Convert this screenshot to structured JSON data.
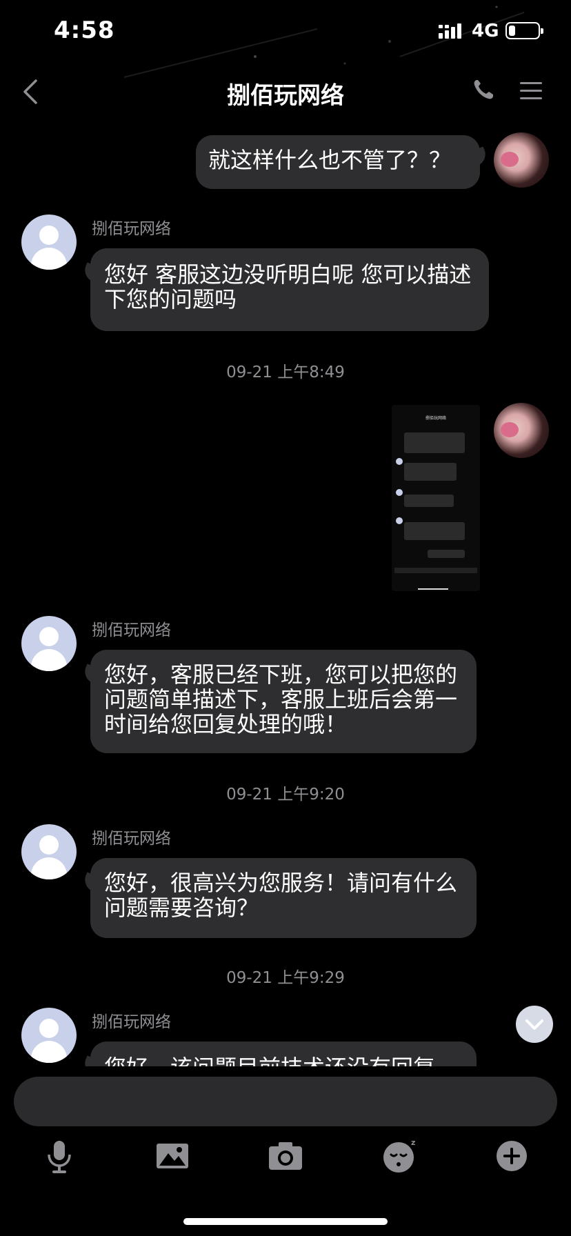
{
  "status_bar": {
    "time": "4:58",
    "network": "4G"
  },
  "nav": {
    "title": "捌佰玩网络"
  },
  "messages": [
    {
      "from": "me",
      "text": "就这样什么也不管了？？"
    },
    {
      "from": "agent",
      "sender": "捌佰玩网络",
      "text": "您好 客服这边没听明白呢 您可以描述下您的问题吗"
    },
    {
      "timestamp": "09-21 上午8:49"
    },
    {
      "from": "me",
      "type": "image"
    },
    {
      "from": "agent",
      "sender": "捌佰玩网络",
      "text": "您好，客服已经下班，您可以把您的问题简单描述下，客服上班后会第一时间给您回复处理的哦！"
    },
    {
      "timestamp": "09-21 上午9:20"
    },
    {
      "from": "agent",
      "sender": "捌佰玩网络",
      "text": "您好，很高兴为您服务！请问有什么问题需要咨询？"
    },
    {
      "timestamp": "09-21 上午9:29"
    },
    {
      "from": "agent",
      "sender": "捌佰玩网络",
      "text": "您好，该问题目前技术还没有回复"
    }
  ],
  "thumbnail": {
    "title": "捌佰玩网络"
  },
  "toolbar": {
    "icons": [
      "microphone-icon",
      "image-icon",
      "camera-icon",
      "emoji-icon",
      "plus-icon"
    ]
  },
  "colors": {
    "background": "#000000",
    "bubble": "#2e2e30",
    "muted_text": "#8f8f94",
    "avatar_default": "#c9d1ea"
  }
}
